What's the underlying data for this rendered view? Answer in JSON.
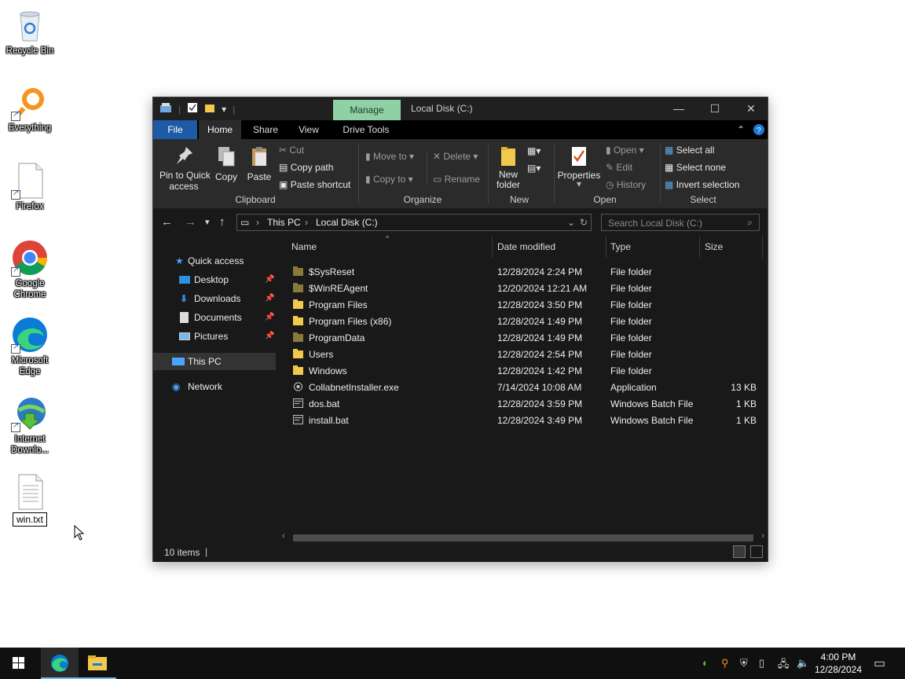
{
  "desktop": {
    "icons": [
      {
        "label": "Recycle Bin",
        "icon": "recycle-bin-icon"
      },
      {
        "label": "Everything",
        "icon": "everything-search-icon"
      },
      {
        "label": "Firefox",
        "icon": "blank-file-icon"
      },
      {
        "label": "Google Chrome",
        "icon": "chrome-icon"
      },
      {
        "label": "Microsoft Edge",
        "icon": "edge-icon"
      },
      {
        "label": "Internet Downlo...",
        "icon": "internet-download-manager-icon"
      },
      {
        "label": "win.txt",
        "icon": "text-file-icon"
      }
    ]
  },
  "window": {
    "title": "Local Disk (C:)",
    "manage_tab": "Manage",
    "tabs": [
      "File",
      "Home",
      "Share",
      "View",
      "Drive Tools"
    ],
    "ribbon": {
      "clipboard": {
        "pin": "Pin to Quick access",
        "pin_l1": "Pin to Quick",
        "pin_l2": "access",
        "copy": "Copy",
        "paste": "Paste",
        "cut": "Cut",
        "copy_path": "Copy path",
        "paste_shortcut": "Paste shortcut",
        "label": "Clipboard"
      },
      "organize": {
        "move_to": "Move to",
        "copy_to": "Copy to",
        "delete": "Delete",
        "rename": "Rename",
        "label": "Organize"
      },
      "new": {
        "new_folder_l1": "New",
        "new_folder_l2": "folder",
        "label": "New"
      },
      "open": {
        "properties": "Properties",
        "open": "Open",
        "edit": "Edit",
        "history": "History",
        "label": "Open"
      },
      "select": {
        "select_all": "Select all",
        "select_none": "Select none",
        "invert": "Invert selection",
        "label": "Select"
      }
    },
    "address": {
      "crumbs": [
        "This PC",
        "Local Disk (C:)"
      ]
    },
    "search_placeholder": "Search Local Disk (C:)",
    "nav": {
      "quick_access": "Quick access",
      "items": [
        {
          "label": "Desktop",
          "pinned": true
        },
        {
          "label": "Downloads",
          "pinned": true
        },
        {
          "label": "Documents",
          "pinned": true
        },
        {
          "label": "Pictures",
          "pinned": true
        }
      ],
      "this_pc": "This PC",
      "network": "Network"
    },
    "columns": [
      "Name",
      "Date modified",
      "Type",
      "Size"
    ],
    "files": [
      {
        "name": "$SysReset",
        "date": "12/28/2024 2:24 PM",
        "type": "File folder",
        "size": "",
        "kind": "folder-dim"
      },
      {
        "name": "$WinREAgent",
        "date": "12/20/2024 12:21 AM",
        "type": "File folder",
        "size": "",
        "kind": "folder-dim"
      },
      {
        "name": "Program Files",
        "date": "12/28/2024 3:50 PM",
        "type": "File folder",
        "size": "",
        "kind": "folder"
      },
      {
        "name": "Program Files (x86)",
        "date": "12/28/2024 1:49 PM",
        "type": "File folder",
        "size": "",
        "kind": "folder"
      },
      {
        "name": "ProgramData",
        "date": "12/28/2024 1:49 PM",
        "type": "File folder",
        "size": "",
        "kind": "folder-dim"
      },
      {
        "name": "Users",
        "date": "12/28/2024 2:54 PM",
        "type": "File folder",
        "size": "",
        "kind": "folder"
      },
      {
        "name": "Windows",
        "date": "12/28/2024 1:42 PM",
        "type": "File folder",
        "size": "",
        "kind": "folder"
      },
      {
        "name": "CollabnetInstaller.exe",
        "date": "7/14/2024 10:08 AM",
        "type": "Application",
        "size": "13 KB",
        "kind": "exe"
      },
      {
        "name": "dos.bat",
        "date": "12/28/2024 3:59 PM",
        "type": "Windows Batch File",
        "size": "1 KB",
        "kind": "bat"
      },
      {
        "name": "install.bat",
        "date": "12/28/2024 3:49 PM",
        "type": "Windows Batch File",
        "size": "1 KB",
        "kind": "bat"
      }
    ],
    "status": "10 items"
  },
  "taskbar": {
    "time": "4:00 PM",
    "date": "12/28/2024"
  },
  "colors": {
    "file_tab": "#1e5ba6",
    "manage_tab": "#8fd1a5",
    "folder": "#f2c94c",
    "accent": "#0078d7"
  }
}
